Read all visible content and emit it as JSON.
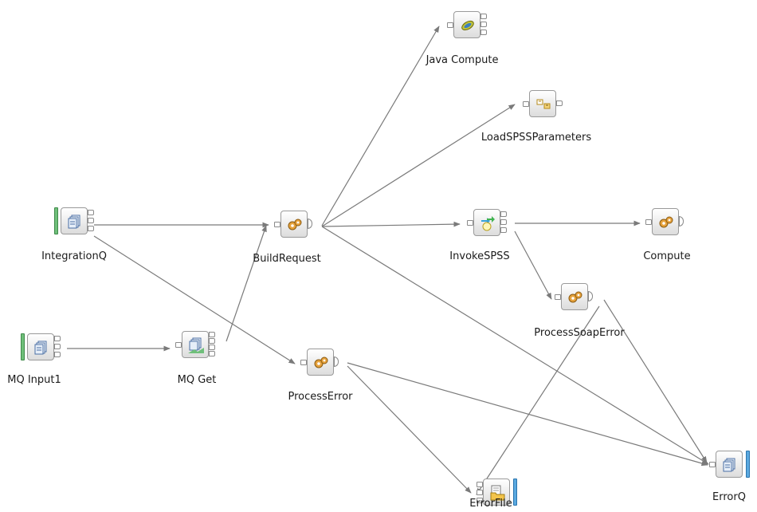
{
  "nodes": [
    {
      "id": "java-compute",
      "label": "Java Compute",
      "icon": "java-icon"
    },
    {
      "id": "load-spss",
      "label": "LoadSPSSParameters",
      "icon": "mapping-icon"
    },
    {
      "id": "integration-q",
      "label": "IntegrationQ",
      "icon": "queue-icon"
    },
    {
      "id": "build-request",
      "label": "BuildRequest",
      "icon": "gears-icon"
    },
    {
      "id": "invoke-spss",
      "label": "InvokeSPSS",
      "icon": "web-service-icon"
    },
    {
      "id": "compute",
      "label": "Compute",
      "icon": "gears-icon"
    },
    {
      "id": "process-soap-error",
      "label": "ProcessSoapError",
      "icon": "gears-icon"
    },
    {
      "id": "mq-input1",
      "label": "MQ Input1",
      "icon": "queue-icon"
    },
    {
      "id": "mq-get",
      "label": "MQ Get",
      "icon": "queue-get-icon"
    },
    {
      "id": "process-error",
      "label": "ProcessError",
      "icon": "gears-icon"
    },
    {
      "id": "error-q",
      "label": "ErrorQ",
      "icon": "queue-icon"
    },
    {
      "id": "error-file",
      "label": "ErrorFile",
      "icon": "file-icon"
    }
  ],
  "colors": {
    "wire": "#7a7a7a",
    "input_bar": "#6fbf7a",
    "output_bar": "#5aa9e0",
    "gear": "#d48a1e"
  }
}
